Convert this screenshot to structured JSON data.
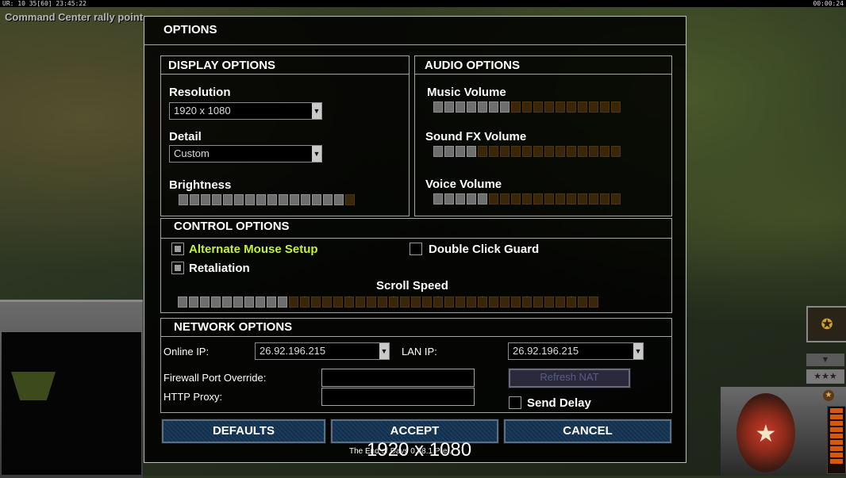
{
  "hud": {
    "top_left": "UR: 10 35[60] 23:45:22",
    "top_right": "00:00:24",
    "rally_text": "Command Center rally point"
  },
  "dialog": {
    "title": "OPTIONS",
    "display": {
      "title": "DISPLAY OPTIONS",
      "resolution_label": "Resolution",
      "resolution_value": "1920 x 1080",
      "detail_label": "Detail",
      "detail_value": "Custom",
      "brightness_label": "Brightness",
      "brightness_level": 15,
      "brightness_total": 16
    },
    "audio": {
      "title": "AUDIO OPTIONS",
      "music_label": "Music Volume",
      "music_level": 7,
      "music_total": 17,
      "sfx_label": "Sound FX Volume",
      "sfx_level": 4,
      "sfx_total": 17,
      "voice_label": "Voice Volume",
      "voice_level": 5,
      "voice_total": 17
    },
    "control": {
      "title": "CONTROL OPTIONS",
      "alt_mouse_label": "Alternate Mouse Setup",
      "alt_mouse_checked": true,
      "double_click_label": "Double Click Guard",
      "double_click_checked": false,
      "retaliation_label": "Retaliation",
      "retaliation_checked": true,
      "scroll_label": "Scroll Speed",
      "scroll_level": 10,
      "scroll_total": 38
    },
    "network": {
      "title": "NETWORK OPTIONS",
      "online_ip_label": "Online IP:",
      "online_ip_value": "26.92.196.215",
      "lan_ip_label": "LAN IP:",
      "lan_ip_value": "26.92.196.215",
      "firewall_label": "Firewall Port Override:",
      "firewall_value": "",
      "proxy_label": "HTTP Proxy:",
      "proxy_value": "",
      "refresh_nat_label": "Refresh NAT",
      "send_delay_label": "Send Delay",
      "send_delay_checked": false
    },
    "buttons": {
      "defaults": "DEFAULTS",
      "accept": "ACCEPT",
      "cancel": "CANCEL"
    },
    "overlay_resolution": "1920 x 1080",
    "footer_text": "The End of Days 0.98.1 Pre..."
  },
  "side_panel": {
    "stars_label": "★★★",
    "down_label": "▼",
    "emblem_star": "★",
    "rank_badge": "★"
  },
  "colors": {
    "highlight_label": "#c4f23a",
    "slider_on": "#6e6e6e",
    "slider_off": "#3a2608",
    "button_fill": "#1a3a5a"
  }
}
